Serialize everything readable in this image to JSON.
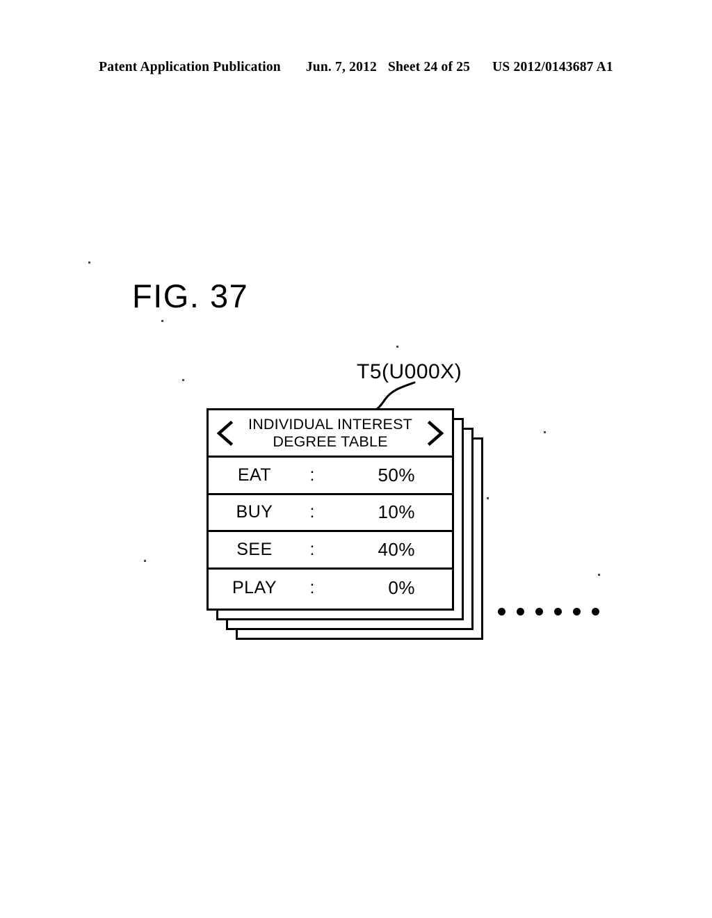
{
  "header": {
    "publication": "Patent Application Publication",
    "date": "Jun. 7, 2012",
    "sheet": "Sheet 24 of 25",
    "doc_number": "US 2012/0143687 A1"
  },
  "figure": {
    "label": "FIG. 37",
    "callout": "T5(U000X)"
  },
  "panel": {
    "prev_arrow": "<",
    "next_arrow": ">",
    "title_line1": "INDIVIDUAL INTEREST",
    "title_line2": "DEGREE TABLE",
    "separator": ":",
    "rows": [
      {
        "key": "EAT",
        "sep": ":",
        "value": "50%"
      },
      {
        "key": "BUY",
        "sep": ":",
        "value": "10%"
      },
      {
        "key": "SEE",
        "sep": ":",
        "value": "40%"
      },
      {
        "key": "PLAY",
        "sep": ":",
        "value": "0%"
      }
    ],
    "stack_count": 3
  },
  "ellipsis": {
    "dot_count": 6
  },
  "colors": {
    "ink": "#000000",
    "paper": "#ffffff"
  }
}
